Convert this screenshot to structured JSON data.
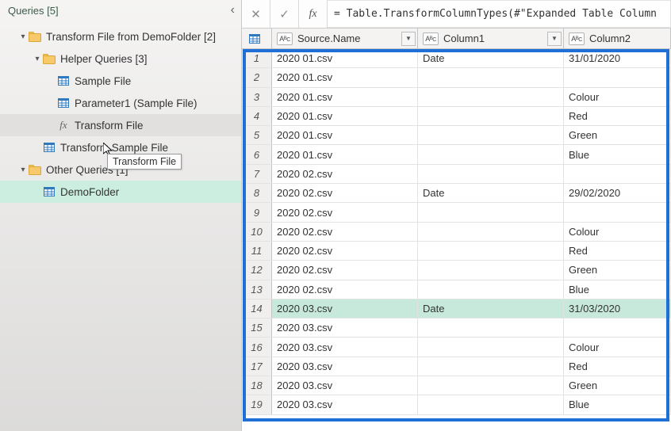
{
  "queries": {
    "title": "Queries [5]",
    "groups": [
      {
        "label": "Transform File from DemoFolder [2]",
        "lvl": 1,
        "arrow": "▾",
        "icon": "folder"
      },
      {
        "label": "Helper Queries [3]",
        "lvl": 2,
        "arrow": "▾",
        "icon": "folder",
        "sub": true
      },
      {
        "label": "Sample File",
        "lvl": 3,
        "icon": "table"
      },
      {
        "label": "Parameter1 (Sample File)",
        "lvl": 3,
        "icon": "table"
      },
      {
        "label": "Transform File",
        "lvl": 3,
        "icon": "fx",
        "state": "selected"
      },
      {
        "label": "Transform Sample File",
        "lvl": 2,
        "icon": "table"
      },
      {
        "label": "Other Queries [1]",
        "lvl": 1,
        "arrow": "▾",
        "icon": "folder"
      },
      {
        "label": "DemoFolder",
        "lvl": 2,
        "icon": "table",
        "state": "highlighted"
      }
    ],
    "tooltip": "Transform File"
  },
  "formula": {
    "cancel": "✕",
    "accept": "✓",
    "fx": "fx",
    "text": "= Table.TransformColumnTypes(#\"Expanded Table Column"
  },
  "columns": {
    "source": "Source.Name",
    "c1": "Column1",
    "c2": "Column2",
    "typelabel": "AᴮC"
  },
  "rows": [
    {
      "n": 1,
      "src": "2020 01.csv",
      "c1": "Date",
      "c2": "31/01/2020"
    },
    {
      "n": 2,
      "src": "2020 01.csv",
      "c1": "",
      "c2": ""
    },
    {
      "n": 3,
      "src": "2020 01.csv",
      "c1": "",
      "c2": "Colour"
    },
    {
      "n": 4,
      "src": "2020 01.csv",
      "c1": "",
      "c2": "Red"
    },
    {
      "n": 5,
      "src": "2020 01.csv",
      "c1": "",
      "c2": "Green"
    },
    {
      "n": 6,
      "src": "2020 01.csv",
      "c1": "",
      "c2": "Blue"
    },
    {
      "n": 7,
      "src": "2020 02.csv",
      "c1": "",
      "c2": ""
    },
    {
      "n": 8,
      "src": "2020 02.csv",
      "c1": "Date",
      "c2": "29/02/2020"
    },
    {
      "n": 9,
      "src": "2020 02.csv",
      "c1": "",
      "c2": ""
    },
    {
      "n": 10,
      "src": "2020 02.csv",
      "c1": "",
      "c2": "Colour"
    },
    {
      "n": 11,
      "src": "2020 02.csv",
      "c1": "",
      "c2": "Red"
    },
    {
      "n": 12,
      "src": "2020 02.csv",
      "c1": "",
      "c2": "Green"
    },
    {
      "n": 13,
      "src": "2020 02.csv",
      "c1": "",
      "c2": "Blue"
    },
    {
      "n": 14,
      "src": "2020 03.csv",
      "c1": "Date",
      "c2": "31/03/2020",
      "hovered": true
    },
    {
      "n": 15,
      "src": "2020 03.csv",
      "c1": "",
      "c2": ""
    },
    {
      "n": 16,
      "src": "2020 03.csv",
      "c1": "",
      "c2": "Colour"
    },
    {
      "n": 17,
      "src": "2020 03.csv",
      "c1": "",
      "c2": "Red"
    },
    {
      "n": 18,
      "src": "2020 03.csv",
      "c1": "",
      "c2": "Green"
    },
    {
      "n": 19,
      "src": "2020 03.csv",
      "c1": "",
      "c2": "Blue"
    }
  ]
}
